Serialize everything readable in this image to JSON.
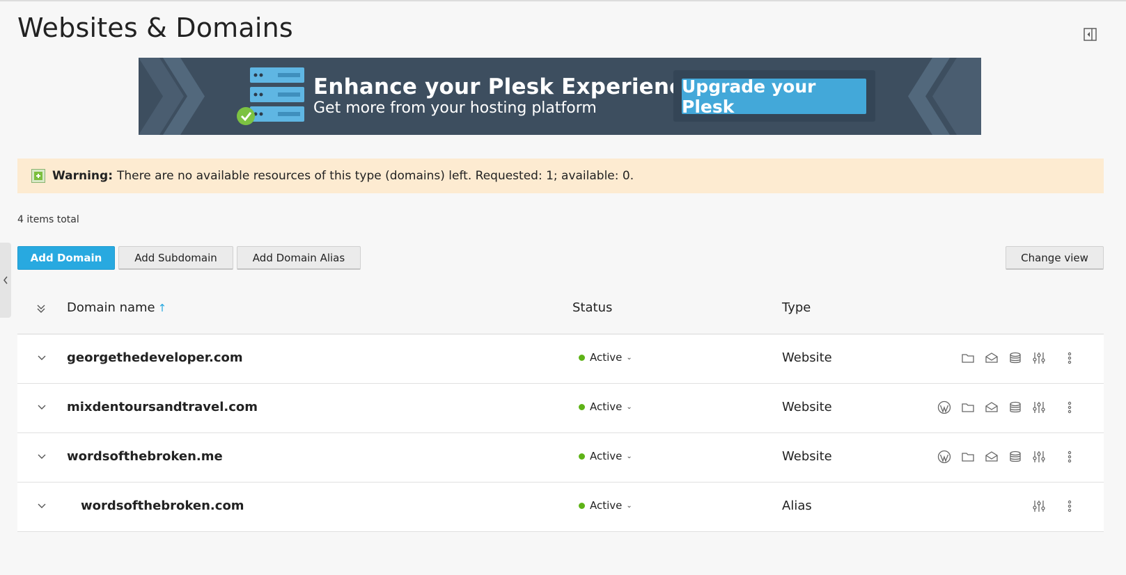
{
  "page": {
    "title": "Websites & Domains"
  },
  "banner": {
    "headline": "Enhance your Plesk Experience",
    "subline": "Get more from your hosting platform",
    "button_label": "Upgrade your Plesk",
    "colors": {
      "background": "#3d4e5f",
      "button": "#43a8d9"
    }
  },
  "warning": {
    "label": "Warning:",
    "message": "There are no available resources of this type (domains) left. Requested: 1; available: 0."
  },
  "list": {
    "items_total": "4 items total"
  },
  "toolbar": {
    "add_domain": "Add Domain",
    "add_subdomain": "Add Subdomain",
    "add_domain_alias": "Add Domain Alias",
    "change_view": "Change view"
  },
  "table": {
    "columns": {
      "domain_name": "Domain name",
      "sort_indicator": "↑",
      "status": "Status",
      "type": "Type"
    },
    "rows": [
      {
        "domain": "georgethedeveloper.com",
        "status": "Active",
        "type": "Website",
        "icons": [
          "folder-icon",
          "mail-icon",
          "database-icon",
          "settings-sliders-icon",
          "more-menu-icon"
        ]
      },
      {
        "domain": "mixdentoursandtravel.com",
        "status": "Active",
        "type": "Website",
        "icons": [
          "wordpress-icon",
          "folder-icon",
          "mail-icon",
          "database-icon",
          "settings-sliders-icon",
          "more-menu-icon"
        ]
      },
      {
        "domain": "wordsofthebroken.me",
        "status": "Active",
        "type": "Website",
        "icons": [
          "wordpress-icon",
          "folder-icon",
          "mail-icon",
          "database-icon",
          "settings-sliders-icon",
          "more-menu-icon"
        ]
      },
      {
        "domain": "wordsofthebroken.com",
        "status": "Active",
        "type": "Alias",
        "indented": true,
        "icons": [
          "settings-sliders-icon",
          "more-menu-icon"
        ]
      }
    ]
  },
  "colors": {
    "primary_button": "#28a9e0",
    "status_active": "#5eb317",
    "warning_background": "#fdebd1"
  }
}
